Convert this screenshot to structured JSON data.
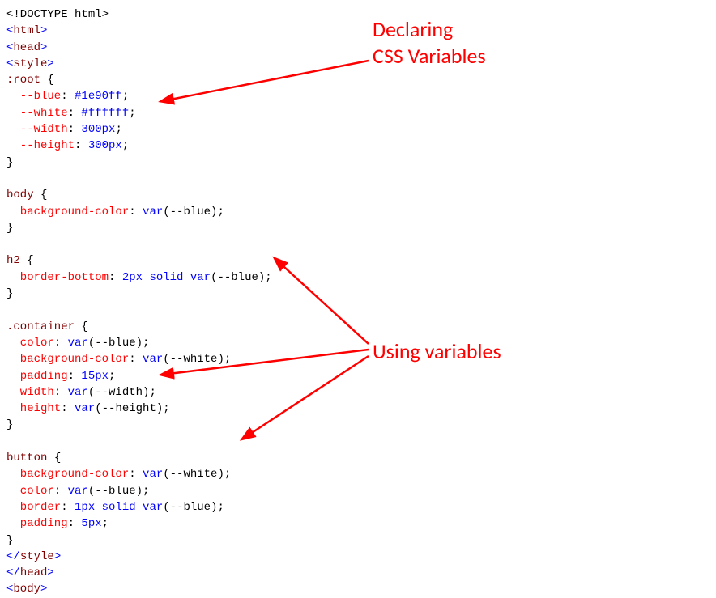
{
  "code": {
    "l01a": "<!DOCTYPE html>",
    "l02a": "<",
    "l02b": "html",
    "l02c": ">",
    "l03a": "<",
    "l03b": "head",
    "l03c": ">",
    "l04a": "<",
    "l04b": "style",
    "l04c": ">",
    "l05a": ":root",
    "l05b": " {",
    "l06a": "  --blue",
    "l06b": ":",
    "l06c": " #1e90ff",
    "l06d": ";",
    "l07a": "  --white",
    "l07b": ":",
    "l07c": " #ffffff",
    "l07d": ";",
    "l08a": "  --width",
    "l08b": ":",
    "l08c": " 300px",
    "l08d": ";",
    "l09a": "  --height",
    "l09b": ":",
    "l09c": " 300px",
    "l09d": ";",
    "l10a": "}",
    "l12a": "body",
    "l12b": " {",
    "l13a": "  background-color",
    "l13b": ":",
    "l13c": " var",
    "l13d": "(--blue);",
    "l14a": "}",
    "l16a": "h2",
    "l16b": " {",
    "l17a": "  border-bottom",
    "l17b": ":",
    "l17c": " 2px",
    "l17d": " solid ",
    "l17e": "var",
    "l17f": "(--blue);",
    "l18a": "}",
    "l20a": ".container",
    "l20b": " {",
    "l21a": "  color",
    "l21b": ":",
    "l21c": " var",
    "l21d": "(--blue);",
    "l22a": "  background-color",
    "l22b": ":",
    "l22c": " var",
    "l22d": "(--white);",
    "l23a": "  padding",
    "l23b": ":",
    "l23c": " 15px",
    "l23d": ";",
    "l24a": "  width",
    "l24b": ":",
    "l24c": " var",
    "l24d": "(--width);",
    "l25a": "  height",
    "l25b": ":",
    "l25c": " var",
    "l25d": "(--height);",
    "l26a": "}",
    "l28a": "button",
    "l28b": " {",
    "l29a": "  background-color",
    "l29b": ":",
    "l29c": " var",
    "l29d": "(--white);",
    "l30a": "  color",
    "l30b": ":",
    "l30c": " var",
    "l30d": "(--blue);",
    "l31a": "  border",
    "l31b": ":",
    "l31c": " 1px",
    "l31d": " solid ",
    "l31e": "var",
    "l31f": "(--blue);",
    "l32a": "  padding",
    "l32b": ":",
    "l32c": " 5px",
    "l32d": ";",
    "l33a": "}",
    "l34a": "</",
    "l34b": "style",
    "l34c": ">",
    "l35a": "</",
    "l35b": "head",
    "l35c": ">",
    "l36a": "<",
    "l36b": "body",
    "l36c": ">"
  },
  "annotations": {
    "declaring_l1": "Declaring",
    "declaring_l2": "CSS Variables",
    "using": "Using variables"
  }
}
